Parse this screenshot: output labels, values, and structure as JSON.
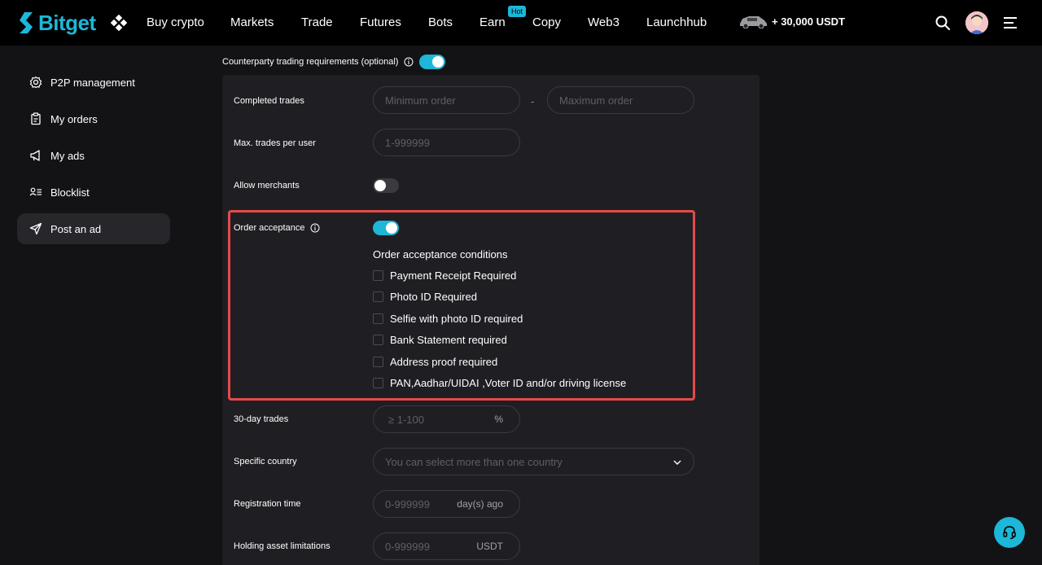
{
  "brand": {
    "name": "Bitget",
    "color": "#1db7d8"
  },
  "nav": {
    "items": [
      "Buy crypto",
      "Markets",
      "Trade",
      "Futures",
      "Bots",
      "Earn",
      "Copy",
      "Web3",
      "Launchhub"
    ],
    "hot_badge": "Hot",
    "promo": "+ 30,000 USDT"
  },
  "sidebar": {
    "items": [
      {
        "label": "P2P management",
        "icon": "gear-icon"
      },
      {
        "label": "My orders",
        "icon": "clipboard-icon"
      },
      {
        "label": "My ads",
        "icon": "megaphone-icon"
      },
      {
        "label": "Blocklist",
        "icon": "user-list-icon"
      },
      {
        "label": "Post an ad",
        "icon": "send-icon",
        "active": true
      }
    ]
  },
  "form": {
    "counterparty_label": "Counterparty trading requirements (optional)",
    "counterparty_enabled": true,
    "completed_trades": {
      "label": "Completed trades",
      "min_placeholder": "Minimum order",
      "max_placeholder": "Maximum order",
      "separator": "-"
    },
    "max_trades": {
      "label": "Max. trades per user",
      "placeholder": "1-999999"
    },
    "allow_merchants": {
      "label": "Allow merchants",
      "enabled": false
    },
    "order_acceptance": {
      "label": "Order acceptance",
      "enabled": true,
      "conditions_title": "Order acceptance conditions",
      "conditions": [
        "Payment Receipt Required",
        "Photo ID Required",
        "Selfie with photo ID required",
        "Bank Statement required",
        "Address proof required",
        "PAN,Aadhar/UIDAI ,Voter ID and/or driving license"
      ]
    },
    "thirty_day_trades": {
      "label": "30-day trades",
      "placeholder": "≥ 1-100",
      "suffix": "%"
    },
    "specific_country": {
      "label": "Specific country",
      "placeholder": "You can select more than one country"
    },
    "registration_time": {
      "label": "Registration time",
      "placeholder": "0-999999",
      "suffix": "day(s) ago"
    },
    "holding_asset": {
      "label": "Holding asset limitations",
      "placeholder": "0-999999",
      "suffix": "USDT"
    }
  }
}
